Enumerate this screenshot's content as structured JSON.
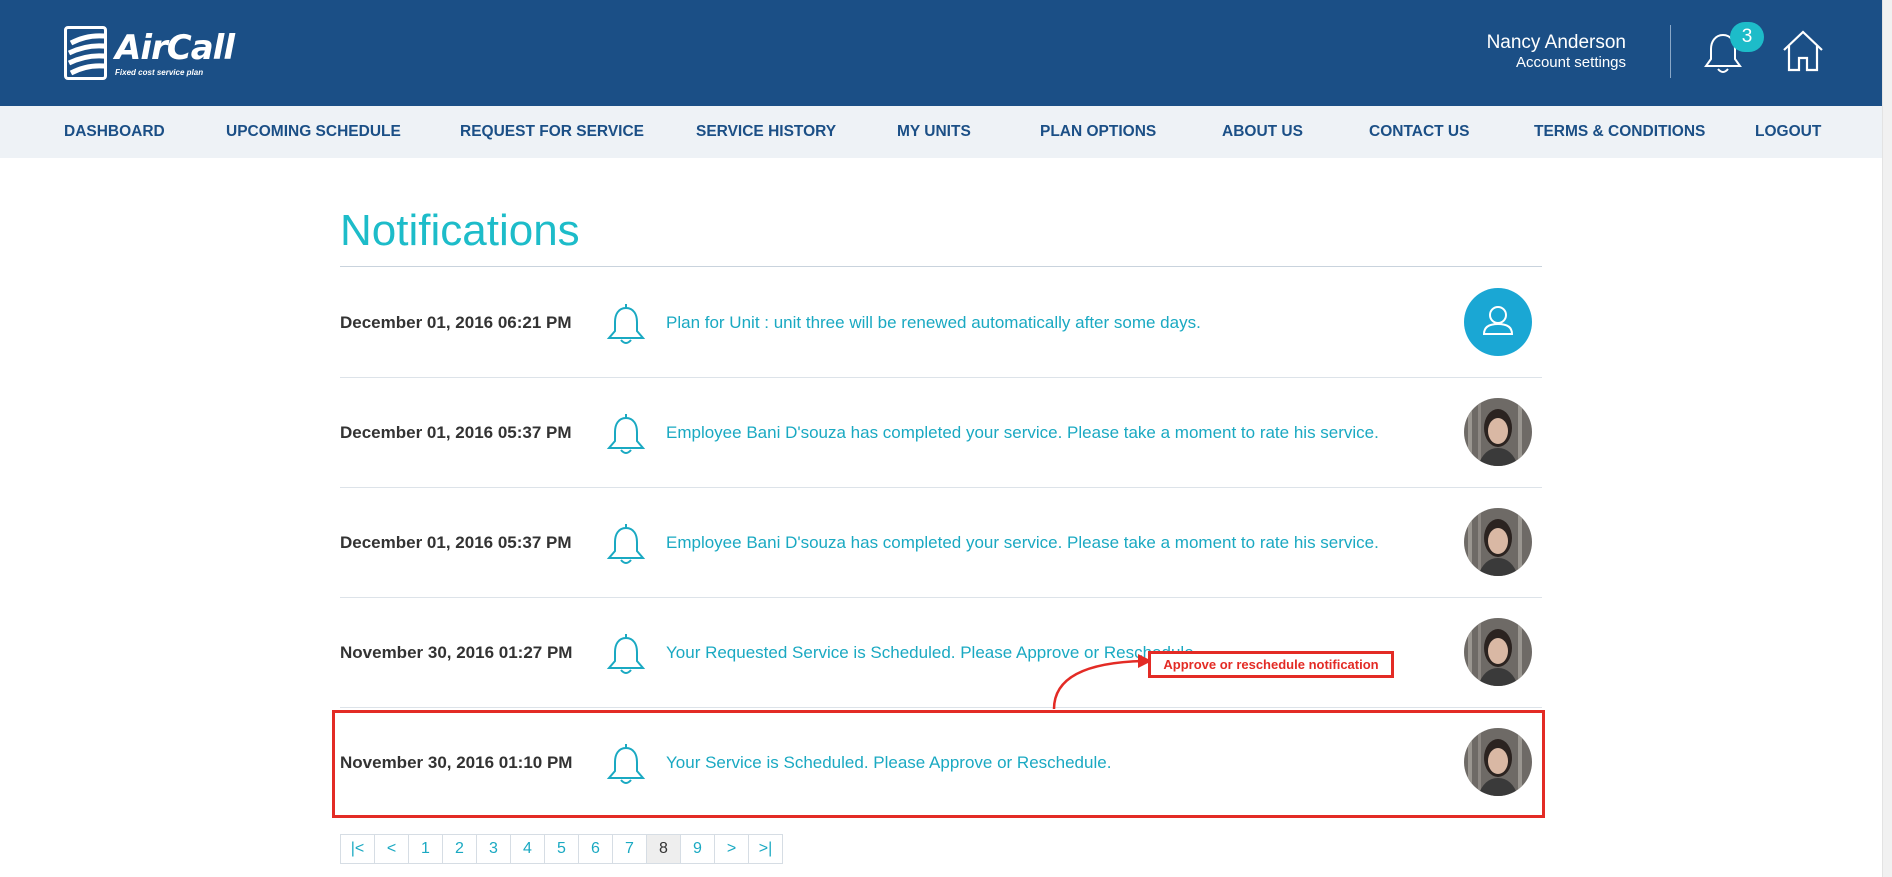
{
  "header": {
    "logo": {
      "name": "AirCall",
      "tagline": "Fixed cost service plan"
    },
    "user_name": "Nancy Anderson",
    "account_settings": "Account settings",
    "notification_count": "3",
    "icons": {
      "notifications": "bell-icon",
      "home": "home-icon"
    }
  },
  "nav": {
    "items": [
      {
        "label": "DASHBOARD"
      },
      {
        "label": "UPCOMING SCHEDULE"
      },
      {
        "label": "REQUEST FOR SERVICE"
      },
      {
        "label": "SERVICE HISTORY"
      },
      {
        "label": "MY UNITS"
      },
      {
        "label": "PLAN OPTIONS"
      },
      {
        "label": "ABOUT US"
      },
      {
        "label": "CONTACT US"
      },
      {
        "label": "TERMS & CONDITIONS"
      },
      {
        "label": "LOGOUT"
      }
    ]
  },
  "page": {
    "title": "Notifications"
  },
  "notifications": [
    {
      "date": "December 01, 2016 06:21 PM",
      "message": "Plan for Unit : unit three will be renewed automatically after some days.",
      "avatar": "generic-user-avatar"
    },
    {
      "date": "December 01, 2016 05:37 PM",
      "message": "Employee Bani D'souza has completed your service. Please take a moment to rate his service.",
      "avatar": "employee-photo"
    },
    {
      "date": "December 01, 2016 05:37 PM",
      "message": "Employee Bani D'souza has completed your service. Please take a moment to rate his service.",
      "avatar": "employee-photo"
    },
    {
      "date": "November 30, 2016 01:27 PM",
      "message": "Your Requested Service is Scheduled. Please Approve or Reschedule.",
      "avatar": "employee-photo"
    },
    {
      "date": "November 30, 2016 01:10 PM",
      "message": "Your Service is Scheduled. Please Approve or Reschedule.",
      "avatar": "employee-photo"
    }
  ],
  "annotation": {
    "label": "Approve or reschedule notification"
  },
  "pagination": {
    "pages": [
      "|<",
      "<",
      "1",
      "2",
      "3",
      "4",
      "5",
      "6",
      "7",
      "8",
      "9",
      ">",
      ">|"
    ],
    "current": "8"
  },
  "colors": {
    "header_bg": "#1b4f86",
    "accent": "#1dbcc9",
    "nav_bg": "#eef2f6",
    "annotation": "#e32b25"
  }
}
